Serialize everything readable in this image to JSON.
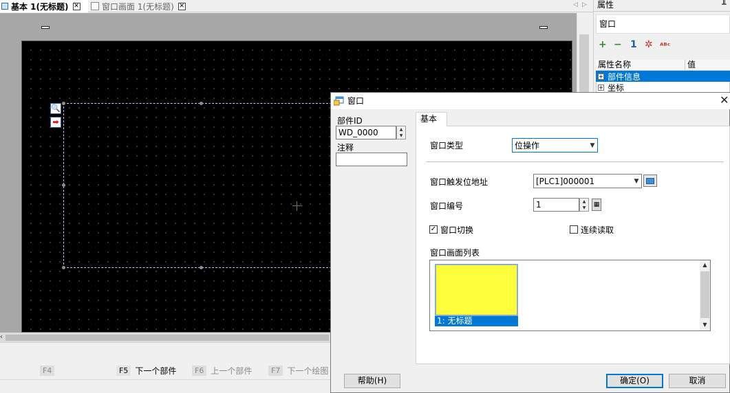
{
  "tabs": [
    {
      "label": "基本 1(无标题)",
      "active": true
    },
    {
      "label": "窗口画面 1(无标题)",
      "active": false
    }
  ],
  "tab_nav": {
    "prev": "◁",
    "next": "▷"
  },
  "tab_close_glyph": "✕",
  "canvas": {
    "side_icons": [
      {
        "name": "magnifier-icon",
        "glyph": "🔍"
      },
      {
        "name": "arrow-right-icon",
        "glyph": "➡"
      }
    ]
  },
  "function_keys": [
    {
      "key": "F4",
      "label": "",
      "enabled": false
    },
    {
      "key": "F5",
      "label": "下一个部件",
      "enabled": true
    },
    {
      "key": "F6",
      "label": "上一个部件",
      "enabled": false
    },
    {
      "key": "F7",
      "label": "下一个绘图",
      "enabled": false
    }
  ],
  "property_panel": {
    "title": "属性",
    "pin_glyph": "╨",
    "selected_object": "窗口",
    "toolbar_icons": [
      "add-all-icon",
      "remove-all-icon",
      "one-icon",
      "select-all-icon",
      "abc-icon"
    ],
    "toolbar_glyphs": [
      "+",
      "−",
      "1",
      "✲",
      "ᴬᴮᶜ"
    ],
    "columns": [
      "属性名称",
      "值"
    ],
    "rows": [
      {
        "label": "部件信息",
        "expand": "+",
        "selected": true
      },
      {
        "label": "坐标",
        "expand": "+",
        "selected": false
      }
    ]
  },
  "dialog": {
    "title": "窗口",
    "close_glyph": "✕",
    "part_id_label": "部件ID",
    "part_id_value": "WD_0000",
    "comment_label": "注释",
    "comment_value": "",
    "tab_label": "基本",
    "window_type_label": "窗口类型",
    "window_type_value": "位操作",
    "trigger_address_label": "窗口触发位地址",
    "trigger_address_value": "[PLC1]000001",
    "window_number_label": "窗口编号",
    "window_number_value": "1",
    "window_switch_label": "窗口切换",
    "window_switch_checked": true,
    "continuous_read_label": "连续读取",
    "continuous_read_checked": false,
    "screen_list_label": "窗口画面列表",
    "screen_list": [
      {
        "label": "1: 无标题",
        "color": "#ffff3c",
        "selected": true
      }
    ],
    "buttons": {
      "help": "帮助(H)",
      "ok": "确定(O)",
      "cancel": "取消"
    }
  }
}
